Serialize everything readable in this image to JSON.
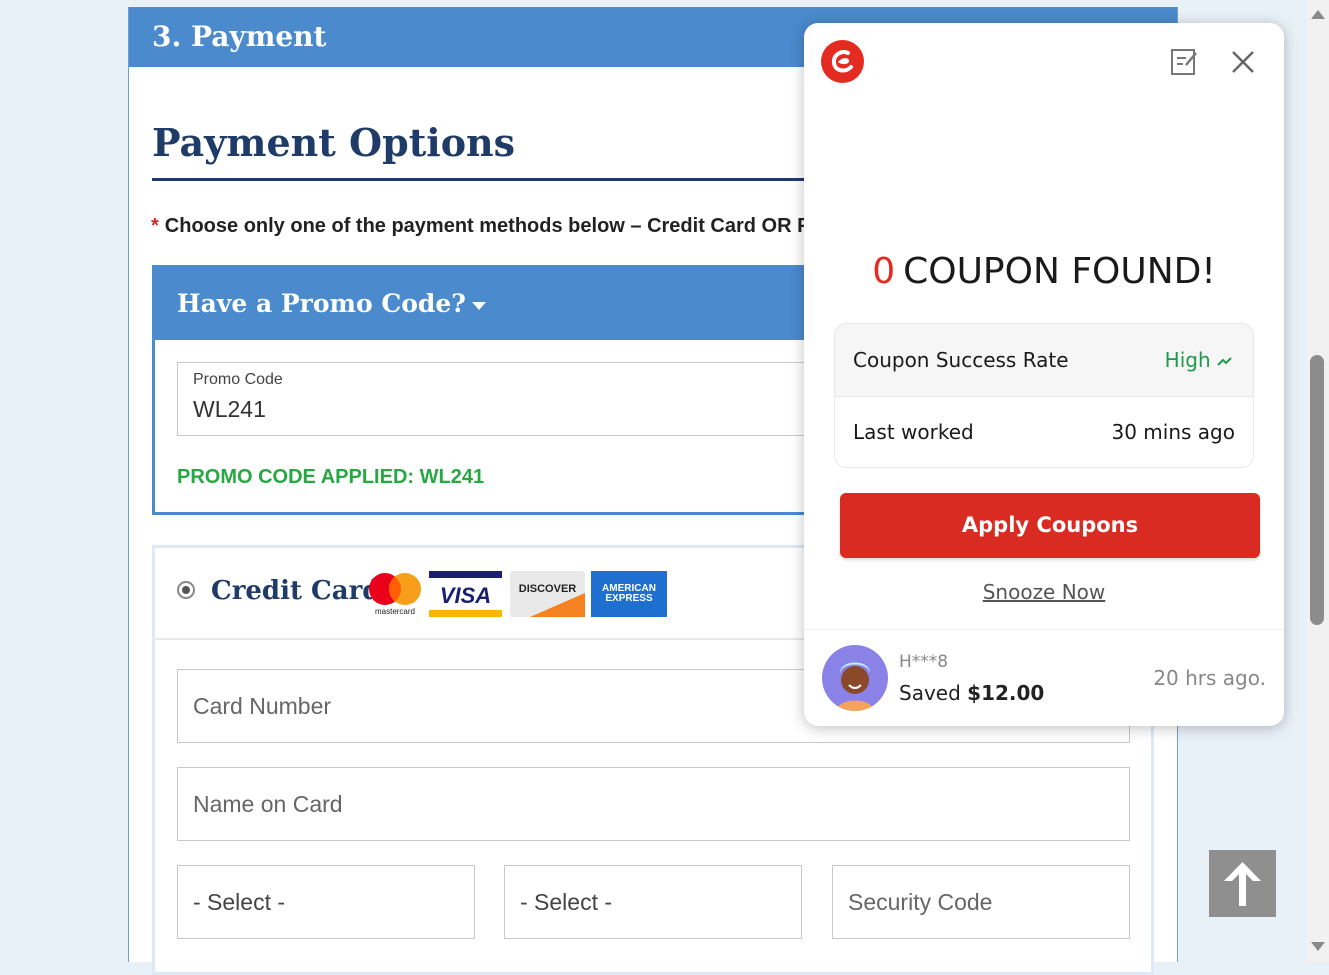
{
  "checkout": {
    "step_title": "3. Payment",
    "section_title": "Payment Options",
    "notice_star": "*",
    "notice_text": "Choose only one of the payment methods below – Credit Card OR P",
    "promo": {
      "header": "Have a Promo Code?",
      "field_label": "Promo Code",
      "field_value": "WL241",
      "applied_message": "PROMO CODE APPLIED: WL241"
    },
    "credit_card": {
      "title": "Credit Card",
      "card_brands": [
        "mastercard",
        "VISA",
        "DISCOVER",
        "AMERICAN EXPRESS"
      ],
      "card_number_placeholder": "Card Number",
      "name_placeholder": "Name on Card",
      "month_select": "- Select -",
      "year_select": "- Select -",
      "security_placeholder": "Security Code"
    }
  },
  "popup": {
    "coupon_count": "0",
    "found_text": "COUPON FOUND!",
    "success_rate_label": "Coupon Success Rate",
    "success_rate_value": "High",
    "last_worked_label": "Last worked",
    "last_worked_value": "30 mins ago",
    "apply_button": "Apply Coupons",
    "snooze_link": "Snooze Now",
    "user": "H***8",
    "saved_prefix": "Saved",
    "saved_amount": "$12.00",
    "time_ago": "20 hrs ago."
  },
  "colors": {
    "header_blue": "#4a8acd",
    "title_navy": "#1f3b67",
    "success_green": "#27a843",
    "coupon_red": "#d92b21"
  },
  "icons": [
    "coupon-logo-icon",
    "edit-icon",
    "close-icon",
    "trend-up-icon",
    "caret-down-icon",
    "arrow-up-icon"
  ]
}
